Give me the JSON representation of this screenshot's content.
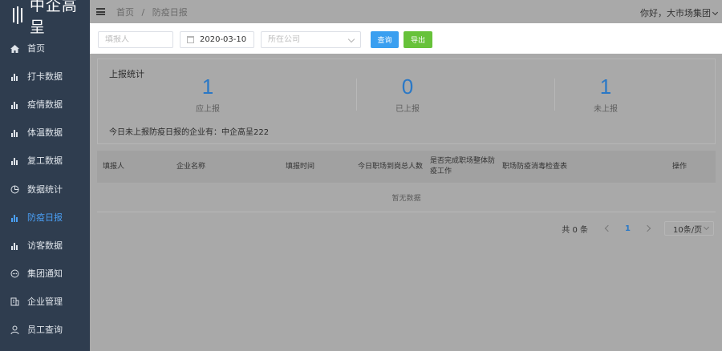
{
  "app": {
    "logo_text": "中企高呈"
  },
  "sidebar": {
    "items": [
      {
        "label": "首页",
        "icon": "home-icon"
      },
      {
        "label": "打卡数据",
        "icon": "bar-chart-icon"
      },
      {
        "label": "疫情数据",
        "icon": "bar-chart-icon"
      },
      {
        "label": "体温数据",
        "icon": "bar-chart-icon"
      },
      {
        "label": "复工数据",
        "icon": "bar-chart-icon"
      },
      {
        "label": "数据统计",
        "icon": "pie-chart-icon"
      },
      {
        "label": "防疫日报",
        "icon": "bar-chart-icon",
        "active": true
      },
      {
        "label": "访客数据",
        "icon": "bar-chart-icon"
      },
      {
        "label": "集团通知",
        "icon": "chat-icon"
      },
      {
        "label": "企业管理",
        "icon": "building-icon"
      },
      {
        "label": "员工查询",
        "icon": "user-icon"
      }
    ],
    "active_color": "#4a9ff5",
    "bg_color": "#2f3d4f"
  },
  "header": {
    "breadcrumb": [
      "首页",
      "防疫日报"
    ],
    "separator": "/",
    "user_greeting": "你好，大市场集团"
  },
  "filters": {
    "name_placeholder": "填报人",
    "date_value": "2020-03-10",
    "company_placeholder": "所在公司",
    "query_label": "查询",
    "export_label": "导出"
  },
  "stats": {
    "title": "上报统计",
    "items": [
      {
        "value": "1",
        "label": "应上报"
      },
      {
        "value": "0",
        "label": "已上报"
      },
      {
        "value": "1",
        "label": "未上报"
      }
    ],
    "notice": "今日未上报防疫日报的企业有：中企高呈222"
  },
  "table": {
    "columns": [
      "填报人",
      "企业名称",
      "填报时间",
      "今日职场到岗总人数",
      "是否完成职场整体防疫工作",
      "职场防疫消毒检查表",
      "操作"
    ],
    "rows": [],
    "empty_text": "暂无数据"
  },
  "pagination": {
    "total_text": "共 0 条",
    "current_page": "1",
    "page_size": "10条/页"
  }
}
